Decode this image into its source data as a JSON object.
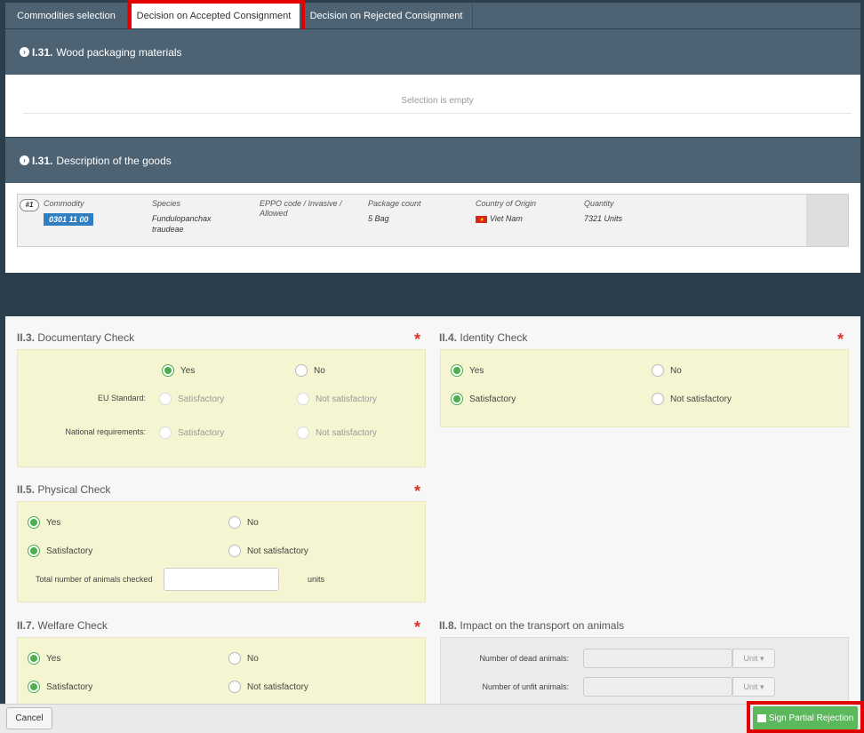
{
  "tabs": [
    {
      "label": "Commodities selection"
    },
    {
      "label": "Decision on Accepted Consignment"
    },
    {
      "label": "Decision on Rejected Consignment"
    }
  ],
  "wood_section": {
    "code": "I.31.",
    "title": "Wood packaging materials",
    "empty_text": "Selection is empty"
  },
  "goods_section": {
    "code": "I.31.",
    "title": "Description of the goods"
  },
  "goods": {
    "index": "#1",
    "columns": {
      "commodity": "Commodity",
      "species": "Species",
      "eppo": "EPPO code / Invasive / Allowed",
      "package": "Package count",
      "origin": "Country of Origin",
      "quantity": "Quantity"
    },
    "commodity_code": "0301 11 00",
    "species_line1": "Fundulopanchax",
    "species_line2": "traudeae",
    "package_count": "5 Bag",
    "country": "Viet Nam",
    "quantity": "7321 Units"
  },
  "documentary": {
    "code": "II.3.",
    "title": "Documentary Check",
    "yes": "Yes",
    "no": "No",
    "eu_label": "EU Standard:",
    "national_label": "National requirements:",
    "satisfactory": "Satisfactory",
    "not_satisfactory": "Not satisfactory"
  },
  "identity": {
    "code": "II.4.",
    "title": "Identity Check",
    "yes": "Yes",
    "no": "No",
    "satisfactory": "Satisfactory",
    "not_satisfactory": "Not satisfactory"
  },
  "physical": {
    "code": "II.5.",
    "title": "Physical Check",
    "yes": "Yes",
    "no": "No",
    "satisfactory": "Satisfactory",
    "not_satisfactory": "Not satisfactory",
    "animals_label": "Total number of animals checked",
    "animals_value": "",
    "units": "units"
  },
  "welfare": {
    "code": "II.7.",
    "title": "Welfare Check",
    "yes": "Yes",
    "no": "No",
    "satisfactory": "Satisfactory",
    "not_satisfactory": "Not satisfactory"
  },
  "transport": {
    "code": "II.8.",
    "title": "Impact on the transport on animals",
    "dead_label": "Number of dead animals:",
    "unfit_label": "Number of unfit animals:",
    "unit_label": "Unit ▾"
  },
  "footer": {
    "cancel": "Cancel",
    "sign": "Sign Partial Rejection"
  },
  "colors": {
    "header": "#4d6272",
    "accent_green": "#5cb85c",
    "commodity_blue": "#2f7fc1",
    "required_red": "#d9332a",
    "highlight_red": "#e30000"
  }
}
